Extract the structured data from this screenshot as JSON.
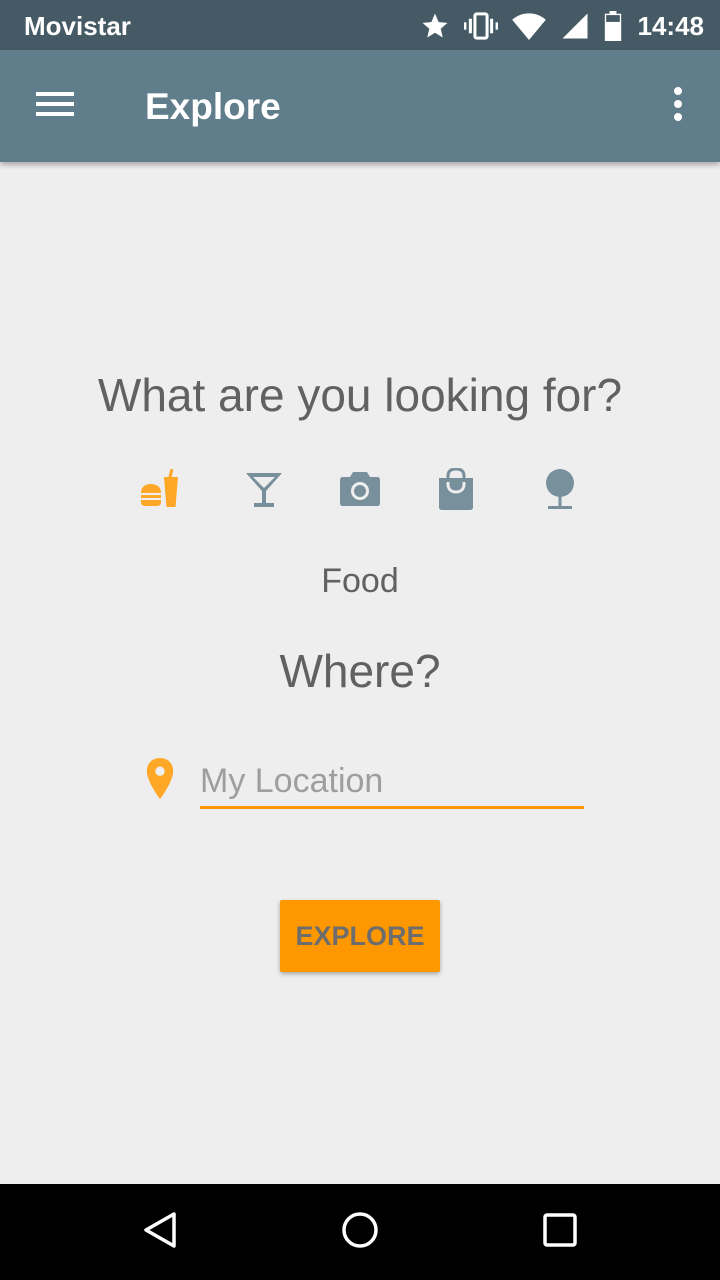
{
  "status_bar": {
    "carrier": "Movistar",
    "time": "14:48",
    "icons": [
      "star-icon",
      "vibrate-icon",
      "wifi-icon",
      "signal-icon",
      "battery-icon"
    ]
  },
  "app_bar": {
    "title": "Explore",
    "icons": [
      "menu-icon",
      "more-vert-icon"
    ]
  },
  "main": {
    "question": "What are you looking for?",
    "categories": [
      {
        "icon": "food-icon",
        "selected": true
      },
      {
        "icon": "cocktail-icon",
        "selected": false
      },
      {
        "icon": "camera-icon",
        "selected": false
      },
      {
        "icon": "shopping-bag-icon",
        "selected": false
      },
      {
        "icon": "tree-icon",
        "selected": false
      }
    ],
    "selected_category_label": "Food",
    "where_label": "Where?",
    "location_placeholder": "My Location",
    "location_value": "",
    "explore_button": "EXPLORE"
  },
  "nav_bar": {
    "icons": [
      "back-icon",
      "home-icon",
      "recents-icon"
    ]
  },
  "colors": {
    "status_bar": "#455a64",
    "app_bar": "#607d8b",
    "accent": "#ff9800",
    "category_icon": "#78909c",
    "category_selected": "#ffa726",
    "text": "#616161",
    "background": "#eeeeee"
  }
}
